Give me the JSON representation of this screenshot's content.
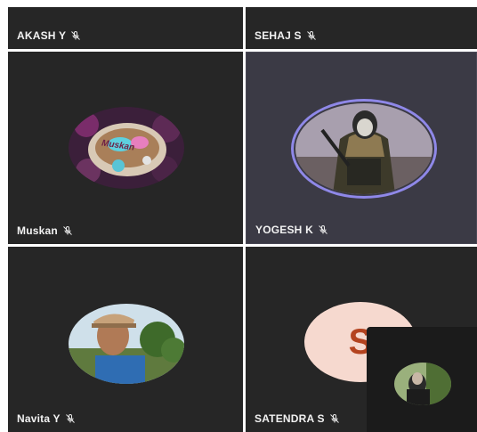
{
  "participants": [
    {
      "name": "AKASH Y",
      "muted": true
    },
    {
      "name": "SEHAJ S",
      "muted": true
    },
    {
      "name": "Muskan",
      "muted": true,
      "avatar": "photo-cake"
    },
    {
      "name": "YOGESH K",
      "muted": true,
      "avatar": "photo-soldier",
      "speaking": true
    },
    {
      "name": "Navita Y",
      "muted": true,
      "avatar": "photo-boy"
    },
    {
      "name": "SATENDRA S",
      "muted": true,
      "avatar_letter": "S"
    }
  ],
  "cake_text": "Muskan",
  "colors": {
    "tile": "#262626",
    "speaking_tile": "#3b3a45",
    "speaking_ring": "#8f88e8",
    "letter_avatar_bg": "#f6d9cf",
    "letter_avatar_fg": "#b4431f"
  },
  "icons": {
    "muted": "mic-off-icon"
  }
}
